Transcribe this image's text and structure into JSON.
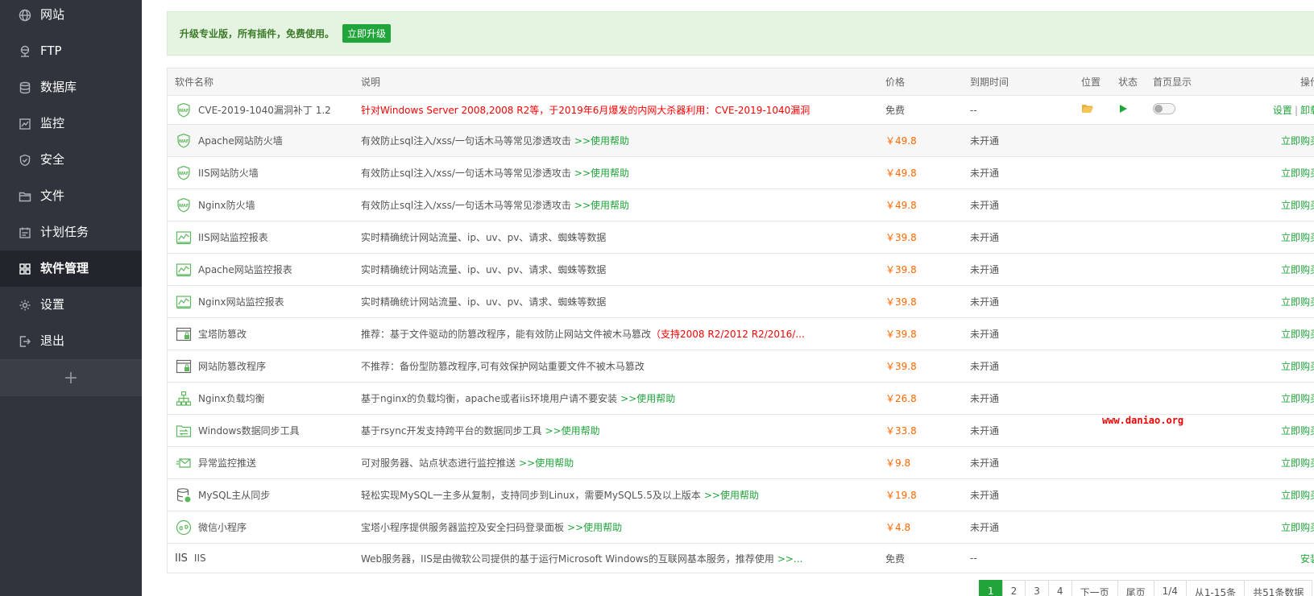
{
  "sidebar": {
    "items": [
      {
        "label": "网站",
        "icon": "globe-icon"
      },
      {
        "label": "FTP",
        "icon": "ftp-icon"
      },
      {
        "label": "数据库",
        "icon": "database-icon"
      },
      {
        "label": "监控",
        "icon": "monitor-icon"
      },
      {
        "label": "安全",
        "icon": "shield-icon"
      },
      {
        "label": "文件",
        "icon": "folder-icon"
      },
      {
        "label": "计划任务",
        "icon": "calendar-icon"
      },
      {
        "label": "软件管理",
        "icon": "grid-icon",
        "active": true
      },
      {
        "label": "设置",
        "icon": "gear-icon"
      },
      {
        "label": "退出",
        "icon": "logout-icon"
      }
    ],
    "add_label": "+"
  },
  "banner": {
    "text": "升级专业版，所有插件，免费使用。",
    "button": "立即升级"
  },
  "table": {
    "headers": {
      "name": "软件名称",
      "desc": "说明",
      "price": "价格",
      "expire": "到期时间",
      "location": "位置",
      "state": "状态",
      "home": "首页显示",
      "op": "操作"
    },
    "rows": [
      {
        "name": "CVE-2019-1040漏洞补丁 1.2",
        "icon": "waf-icon",
        "desc": "针对Windows Server 2008,2008 R2等，于2019年6月爆发的内网大杀器利用：CVE-2019-1040漏洞",
        "price": "免费",
        "expire": "--",
        "op1": "设置",
        "op2": "卸载"
      },
      {
        "name": "Apache网站防火墙",
        "icon": "waf-icon",
        "desc": "有效防止sql注入/xss/一句话木马等常见渗透攻击",
        "help": ">>使用帮助",
        "price": "￥49.8",
        "expire": "未开通",
        "op": "立即购买"
      },
      {
        "name": "IIS网站防火墙",
        "icon": "waf-icon",
        "desc": "有效防止sql注入/xss/一句话木马等常见渗透攻击",
        "help": ">>使用帮助",
        "price": "￥49.8",
        "expire": "未开通",
        "op": "立即购买"
      },
      {
        "name": "Nginx防火墙",
        "icon": "waf-icon",
        "desc": "有效防止sql注入/xss/一句话木马等常见渗透攻击",
        "help": ">>使用帮助",
        "price": "￥49.8",
        "expire": "未开通",
        "op": "立即购买"
      },
      {
        "name": "IIS网站监控报表",
        "icon": "chart-icon",
        "desc": "实时精确统计网站流量、ip、uv、pv、请求、蜘蛛等数据",
        "price": "￥39.8",
        "expire": "未开通",
        "op": "立即购买"
      },
      {
        "name": "Apache网站监控报表",
        "icon": "chart-icon",
        "desc": "实时精确统计网站流量、ip、uv、pv、请求、蜘蛛等数据",
        "price": "￥39.8",
        "expire": "未开通",
        "op": "立即购买"
      },
      {
        "name": "Nginx网站监控报表",
        "icon": "chart-icon",
        "desc": "实时精确统计网站流量、ip、uv、pv、请求、蜘蛛等数据",
        "price": "￥39.8",
        "expire": "未开通",
        "op": "立即购买"
      },
      {
        "name": "宝塔防篡改",
        "icon": "browser-lock-icon",
        "desc": "推荐：基于文件驱动的防篡改程序，能有效防止网站文件被木马篡改",
        "desc_red": "（支持2008 R2/2012 R2/2016/...",
        "price": "￥39.8",
        "expire": "未开通",
        "op": "立即购买"
      },
      {
        "name": "网站防篡改程序",
        "icon": "browser-lock-icon",
        "desc": "不推荐：备份型防篡改程序,可有效保护网站重要文件不被木马篡改",
        "price": "￥39.8",
        "expire": "未开通",
        "op": "立即购买"
      },
      {
        "name": "Nginx负载均衡",
        "icon": "network-icon",
        "desc": "基于nginx的负载均衡，apache或者iis环境用户请不要安装",
        "help": ">>使用帮助",
        "price": "￥26.8",
        "expire": "未开通",
        "op": "立即购买"
      },
      {
        "name": "Windows数据同步工具",
        "icon": "sync-folder-icon",
        "desc": "基于rsync开发支持跨平台的数据同步工具",
        "help": ">>使用帮助",
        "price": "￥33.8",
        "expire": "未开通",
        "op": "立即购买"
      },
      {
        "name": "异常监控推送",
        "icon": "mail-send-icon",
        "desc": "可对服务器、站点状态进行监控推送",
        "help": ">>使用帮助",
        "price": "￥9.8",
        "expire": "未开通",
        "op": "立即购买"
      },
      {
        "name": "MySQL主从同步",
        "icon": "db-sync-icon",
        "desc": "轻松实现MySQL一主多从复制，支持同步到Linux，需要MySQL5.5及以上版本",
        "help": ">>使用帮助",
        "price": "￥19.8",
        "expire": "未开通",
        "op": "立即购买"
      },
      {
        "name": "微信小程序",
        "icon": "wechat-mini-icon",
        "desc": "宝塔小程序提供服务器监控及安全扫码登录面板",
        "help": ">>使用帮助",
        "price": "￥4.8",
        "expire": "未开通",
        "op": "立即购买"
      },
      {
        "name": "IIS",
        "icon": "iis-icon",
        "icon_text": "IIS",
        "desc": "Web服务器，IIS是由微软公司提供的基于运行Microsoft Windows的互联网基本服务，推荐使用",
        "help": ">>...",
        "price": "免费",
        "expire": "--",
        "op": "安装"
      }
    ]
  },
  "watermark": "www.daniao.org",
  "pager": {
    "pages": [
      "1",
      "2",
      "3",
      "4"
    ],
    "next": "下一页",
    "last": "尾页",
    "page_info": "1/4",
    "range": "从1-15条",
    "total": "共51条数据"
  },
  "colors": {
    "sidebar_bg": "#30343d",
    "accent": "#20a53a",
    "price": "#ff6600",
    "warning": "#ff0000"
  }
}
